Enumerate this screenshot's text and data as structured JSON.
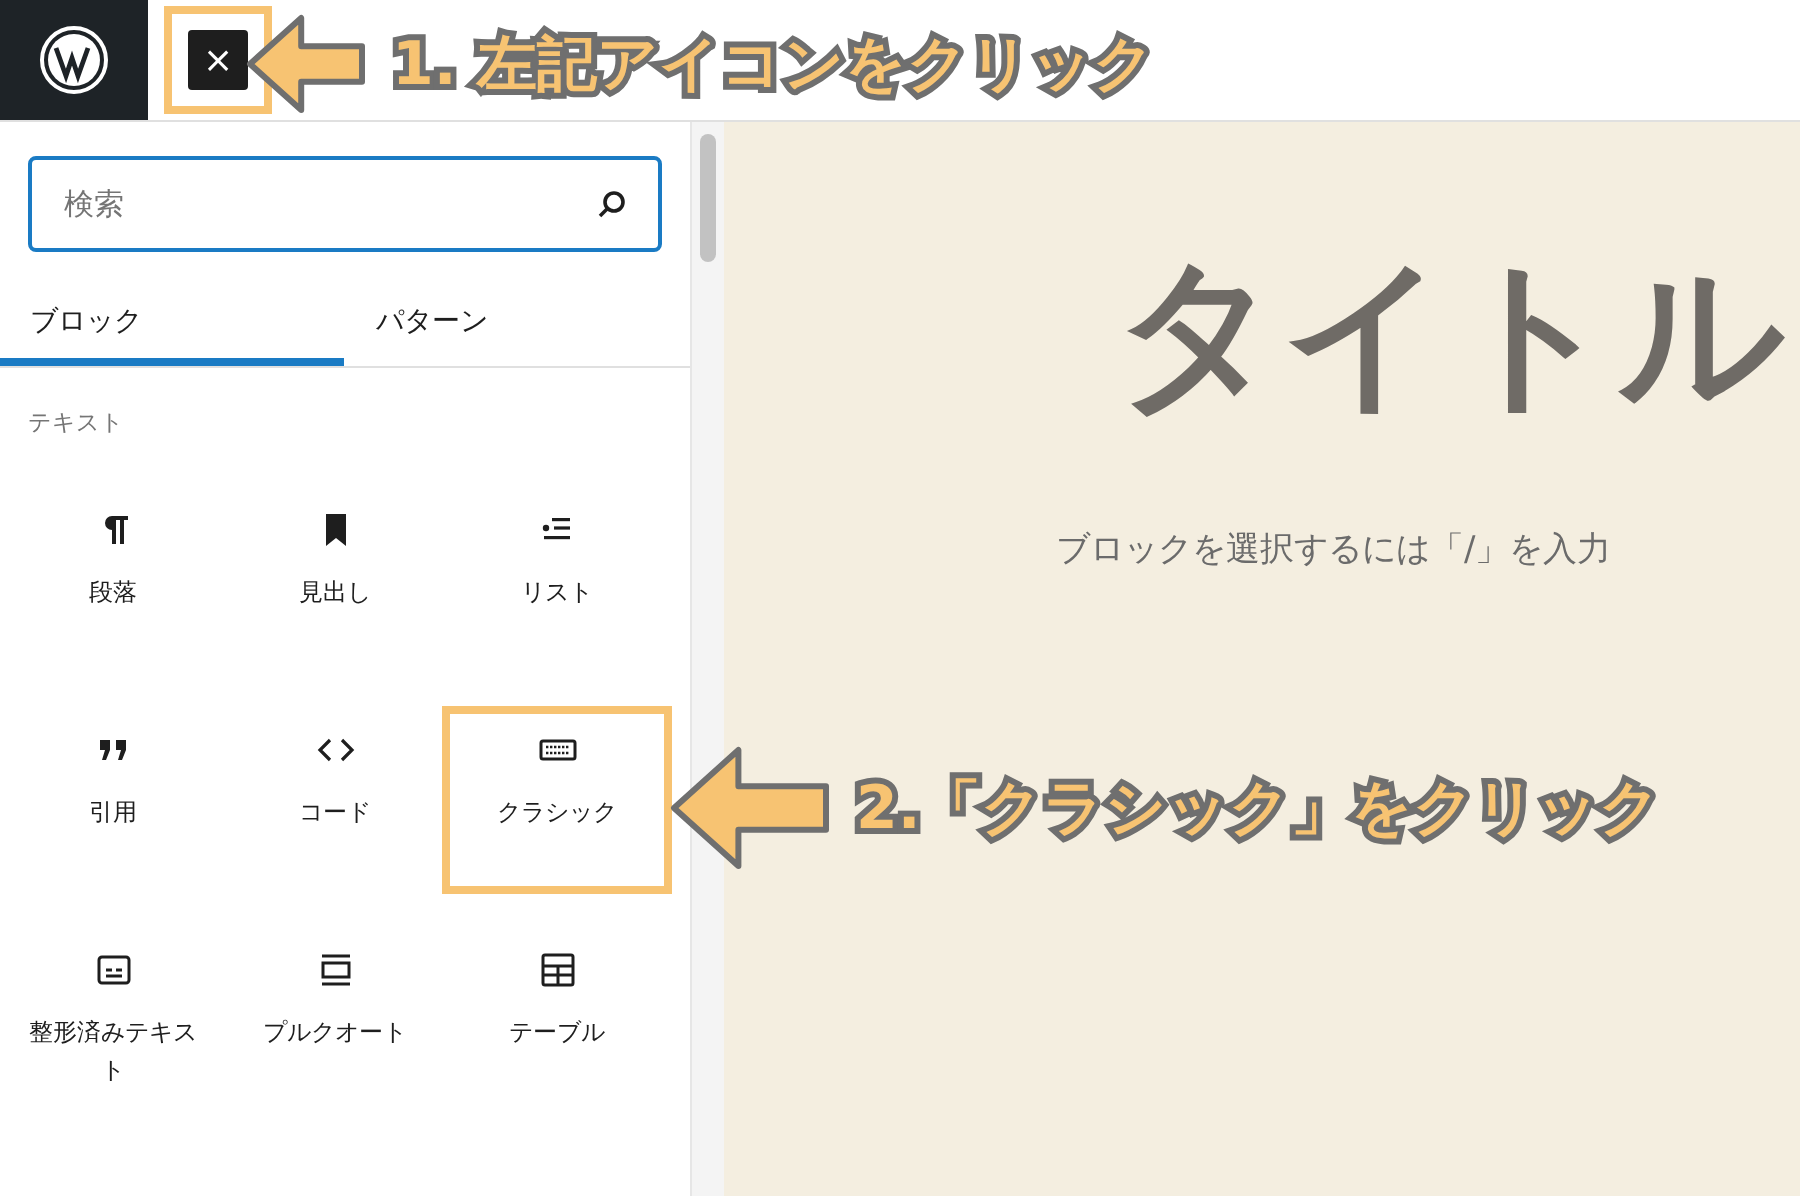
{
  "topbar": {
    "close_button": {
      "label": "×",
      "highlighted": true
    }
  },
  "annotations": [
    {
      "text": "1. 左記アイコンをクリック"
    },
    {
      "text": "2.「クラシック」をクリック"
    }
  ],
  "sidebar": {
    "search": {
      "placeholder": "検索"
    },
    "tabs": [
      {
        "label": "ブロック",
        "selected": true
      },
      {
        "label": "パターン",
        "selected": false
      }
    ],
    "section_title": "テキスト",
    "blocks": [
      {
        "label": "段落",
        "highlighted": false
      },
      {
        "label": "見出し",
        "highlighted": false
      },
      {
        "label": "リスト",
        "highlighted": false
      },
      {
        "label": "引用",
        "highlighted": false
      },
      {
        "label": "コード",
        "highlighted": false
      },
      {
        "label": "クラシック",
        "highlighted": true
      },
      {
        "label": "整形済みテキスト",
        "highlighted": false
      },
      {
        "label": "プルクオート",
        "highlighted": false
      },
      {
        "label": "テーブル",
        "highlighted": false
      }
    ]
  },
  "canvas": {
    "title": "タイトル",
    "placeholder": "ブロックを選択するには「/」を入力"
  }
}
